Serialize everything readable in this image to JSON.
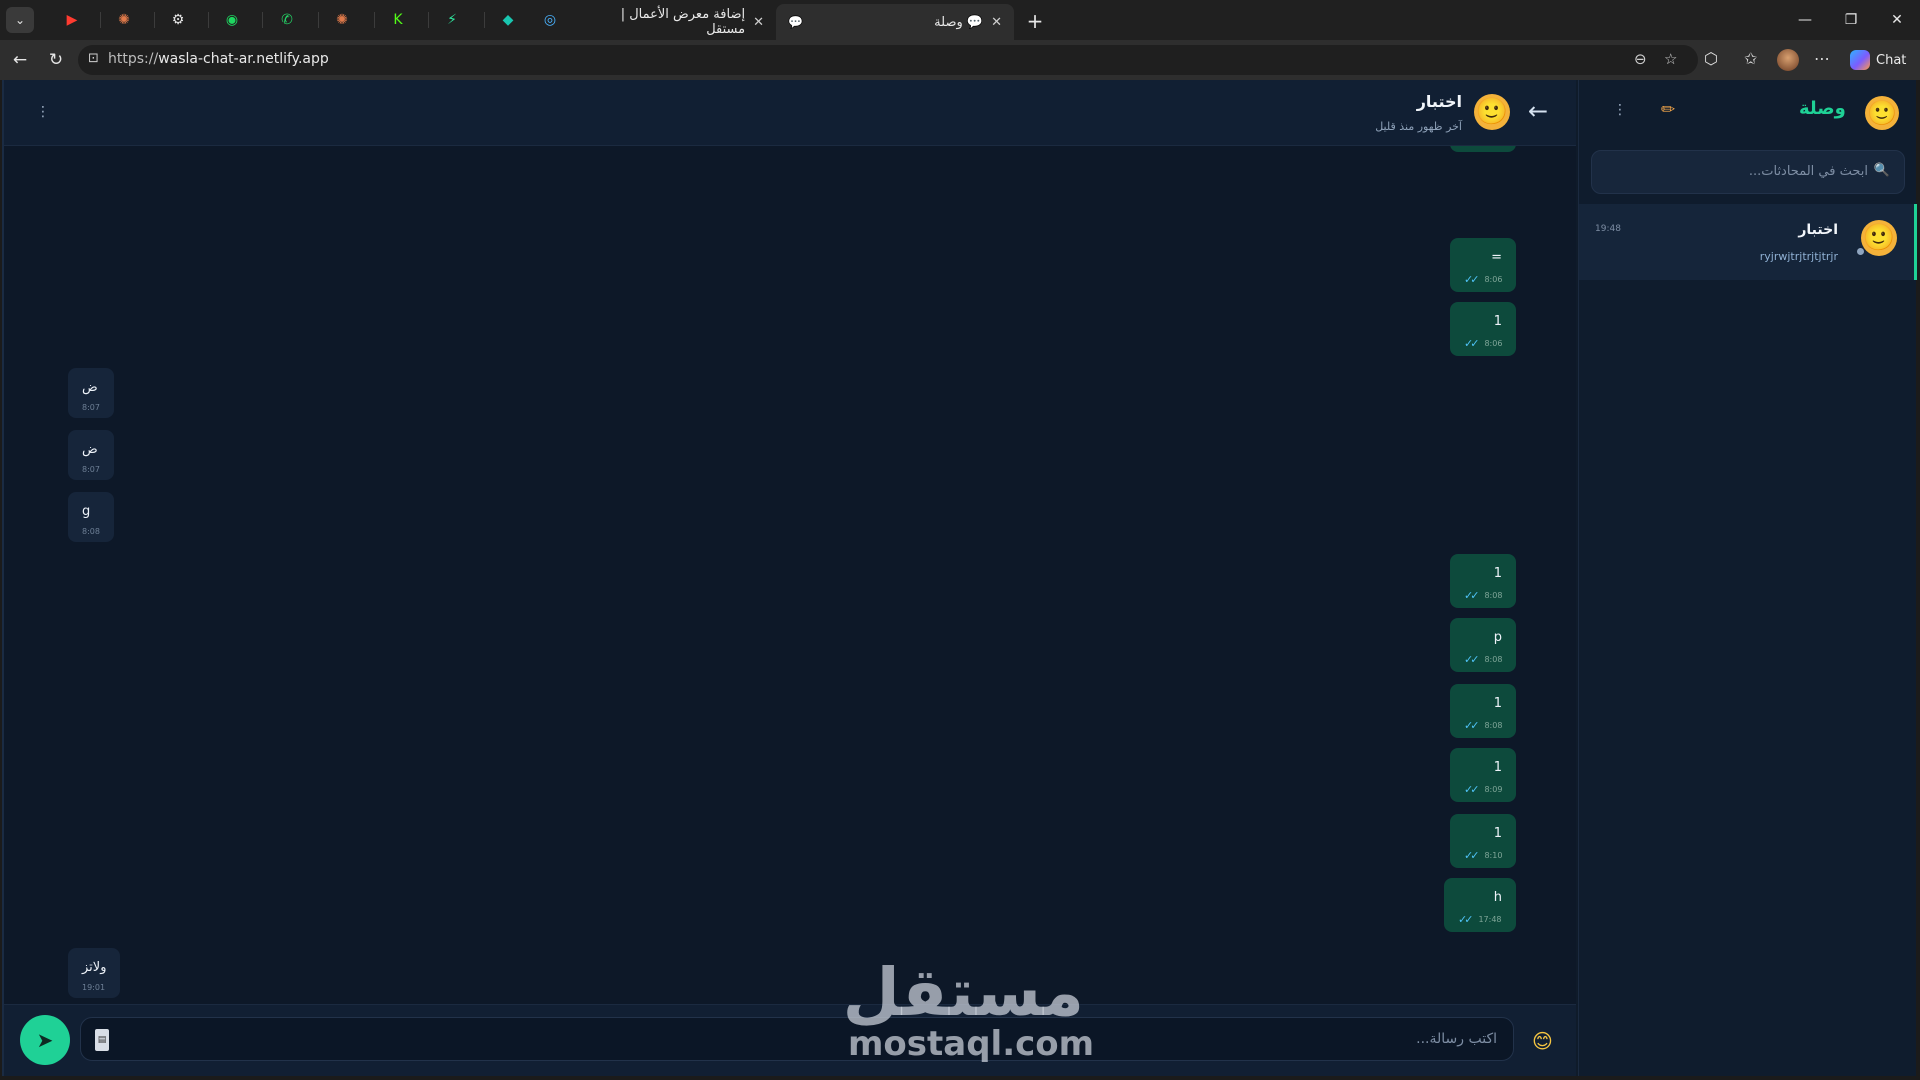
{
  "browser": {
    "pinned_tabs": [
      {
        "icon": "youtube-icon",
        "glyph": "▶",
        "color": "#ff3b30"
      },
      {
        "icon": "claude-icon",
        "glyph": "✺",
        "color": "#e07a4a"
      },
      {
        "icon": "chatgpt-icon",
        "glyph": "⚙",
        "color": "#e8e8e8"
      },
      {
        "icon": "spotify-icon",
        "glyph": "◉",
        "color": "#1ed760"
      },
      {
        "icon": "whatsapp-icon",
        "glyph": "✆",
        "color": "#25d366"
      },
      {
        "icon": "claude-icon",
        "glyph": "✺",
        "color": "#e07a4a"
      },
      {
        "icon": "kick-icon",
        "glyph": "K",
        "color": "#53fc18"
      },
      {
        "icon": "activity-icon",
        "glyph": "⚡",
        "color": "#2ee59d"
      },
      {
        "icon": "diamond-icon",
        "glyph": "◆",
        "color": "#19c6b0"
      },
      {
        "icon": "circle-app-icon",
        "glyph": "◎",
        "color": "#4ab3ff"
      }
    ],
    "tabs": [
      {
        "title": "إضافة معرض الأعمال | مستقل",
        "active": false
      },
      {
        "title": "وصلة 💬",
        "active": true
      }
    ],
    "url_scheme": "https://",
    "url_host": "wasla-chat-ar.netlify.app",
    "copilot_label": "Chat"
  },
  "chat": {
    "contact_name": "اختبار",
    "contact_status": "آخر ظهور منذ قليل",
    "messages": [
      {
        "dir": "out",
        "text": "",
        "time": "",
        "partial": true
      },
      {
        "dir": "out",
        "text": "=",
        "time": "8:06"
      },
      {
        "dir": "out",
        "text": "1",
        "time": "8:06"
      },
      {
        "dir": "in",
        "text": "ض",
        "time": "8:07"
      },
      {
        "dir": "in",
        "text": "ض",
        "time": "8:07"
      },
      {
        "dir": "in",
        "text": "g",
        "time": "8:08"
      },
      {
        "dir": "out",
        "text": "1",
        "time": "8:08"
      },
      {
        "dir": "out",
        "text": "p",
        "time": "8:08"
      },
      {
        "dir": "out",
        "text": "1",
        "time": "8:08"
      },
      {
        "dir": "out",
        "text": "1",
        "time": "8:09"
      },
      {
        "dir": "out",
        "text": "1",
        "time": "8:10"
      },
      {
        "dir": "out",
        "text": "h",
        "time": "17:48"
      },
      {
        "dir": "in",
        "text": "ولاتز",
        "time": "19:01"
      },
      {
        "dir": "in",
        "text": "ryjrwjtrjtrjtjtrjr",
        "time": "19:48"
      }
    ],
    "input_placeholder": "اكتب رسالة...",
    "send_icon": "send-icon",
    "emoji_icon": "emoji-icon"
  },
  "sidebar": {
    "brand": "وصلة",
    "search_placeholder": "ابحث في المحادثات...",
    "conversations": [
      {
        "name": "اختبار",
        "last": "ryjrwjtrjtrjtjtrjr",
        "time": "19:48",
        "active": true
      }
    ]
  },
  "watermark": {
    "ar": "مستقل",
    "en": "mostaql.com"
  },
  "colors": {
    "accent": "#1fd196",
    "outgoing_bubble": "#0d4a3c",
    "incoming_bubble": "#16253a",
    "page_bg": "#0d1828"
  }
}
